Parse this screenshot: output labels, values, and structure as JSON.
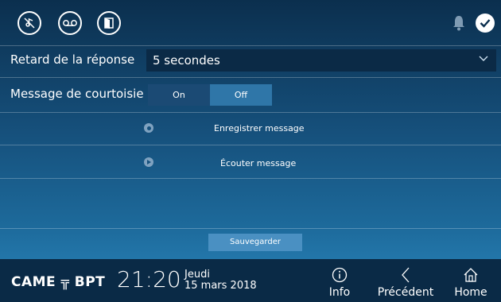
{
  "settings": {
    "answer_delay_label": "Retard de la réponse",
    "answer_delay_value": "5 secondes",
    "courtesy_label": "Message de courtoisie",
    "courtesy_on": "On",
    "courtesy_off": "Off",
    "record_message": "Enregistrer message",
    "listen_message": "Écouter message",
    "save": "Sauvegarder"
  },
  "footer": {
    "brand": "CAME ╦ BPT",
    "time": "21:20",
    "day": "Jeudi",
    "date": "15 mars 2018",
    "info": "Info",
    "previous": "Précédent",
    "home": "Home"
  },
  "state": {
    "courtesy_selected": "Off"
  }
}
